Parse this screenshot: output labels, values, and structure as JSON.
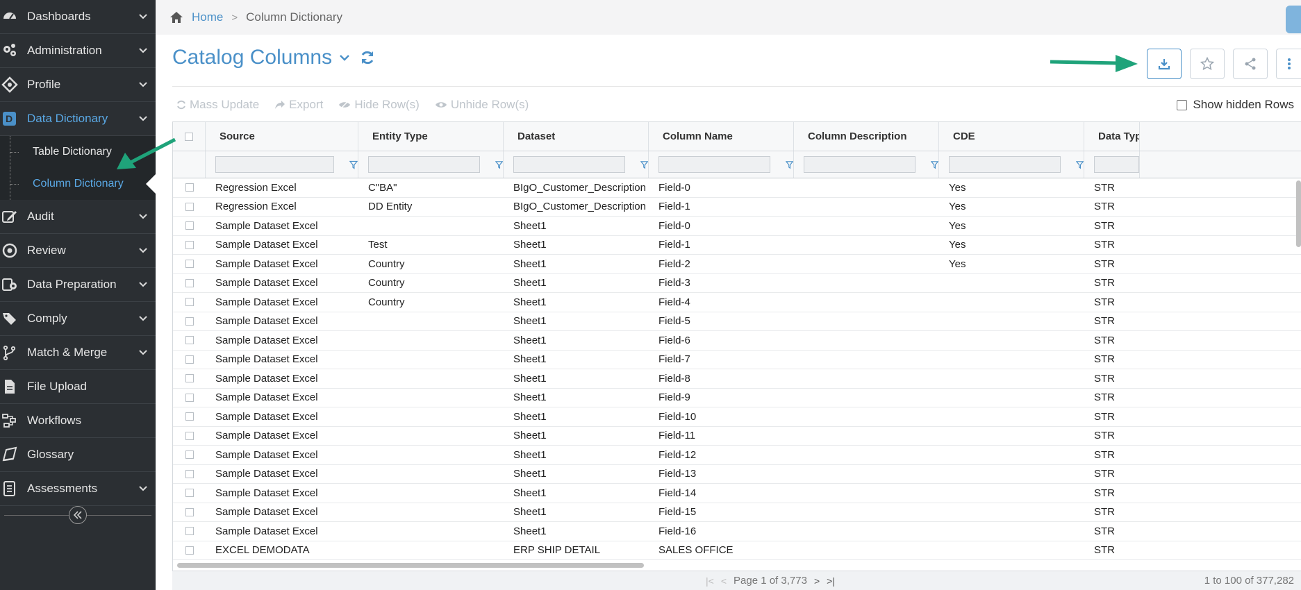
{
  "sidebar": {
    "items": [
      {
        "label": "Dashboards",
        "icon": "dashboard-icon",
        "expandable": true
      },
      {
        "label": "Administration",
        "icon": "gears-icon",
        "expandable": true
      },
      {
        "label": "Profile",
        "icon": "profile-icon",
        "expandable": true
      },
      {
        "label": "Data Dictionary",
        "icon": "data-dictionary-icon",
        "expandable": true,
        "active": true
      },
      {
        "label": "Audit",
        "icon": "audit-edit-icon",
        "expandable": true
      },
      {
        "label": "Review",
        "icon": "review-icon",
        "expandable": true
      },
      {
        "label": "Data Preparation",
        "icon": "data-preparation-icon",
        "expandable": true
      },
      {
        "label": "Comply",
        "icon": "tags-icon",
        "expandable": true
      },
      {
        "label": "Match & Merge",
        "icon": "branch-icon",
        "expandable": true
      },
      {
        "label": "File Upload",
        "icon": "file-icon",
        "expandable": false
      },
      {
        "label": "Workflows",
        "icon": "workflow-icon",
        "expandable": false
      },
      {
        "label": "Glossary",
        "icon": "book-icon",
        "expandable": false
      },
      {
        "label": "Assessments",
        "icon": "assessment-icon",
        "expandable": true
      }
    ],
    "sub_items": [
      {
        "label": "Table Dictionary"
      },
      {
        "label": "Column Dictionary",
        "current": true
      }
    ],
    "collapse_icon": "double-chevron-left-icon"
  },
  "breadcrumb": {
    "home": "Home",
    "current": "Column Dictionary"
  },
  "title": "Catalog Columns",
  "toolbar": {
    "mass_update": "Mass Update",
    "export": "Export",
    "hide_rows": "Hide Row(s)",
    "unhide_rows": "Unhide Row(s)",
    "show_hidden": "Show hidden Rows"
  },
  "colors": {
    "accent": "#4a90c8",
    "sidebar": "#2b2f33",
    "annotation_arrow": "#1fa37a"
  },
  "grid": {
    "columns": [
      "Source",
      "Entity Type",
      "Dataset",
      "Column Name",
      "Column Description",
      "CDE",
      "Data Typ"
    ],
    "rows": [
      [
        "Regression Excel",
        "C\"BA\"",
        "BIgO_Customer_Description",
        "Field-0",
        "",
        "Yes",
        "STR"
      ],
      [
        "Regression Excel",
        "DD Entity",
        "BIgO_Customer_Description",
        "Field-1",
        "",
        "Yes",
        "STR"
      ],
      [
        "Sample Dataset Excel",
        "",
        "Sheet1",
        "Field-0",
        "",
        "Yes",
        "STR"
      ],
      [
        "Sample Dataset Excel",
        "Test",
        "Sheet1",
        "Field-1",
        "",
        "Yes",
        "STR"
      ],
      [
        "Sample Dataset Excel",
        "Country",
        "Sheet1",
        "Field-2",
        "",
        "Yes",
        "STR"
      ],
      [
        "Sample Dataset Excel",
        "Country",
        "Sheet1",
        "Field-3",
        "",
        "",
        "STR"
      ],
      [
        "Sample Dataset Excel",
        "Country",
        "Sheet1",
        "Field-4",
        "",
        "",
        "STR"
      ],
      [
        "Sample Dataset Excel",
        "",
        "Sheet1",
        "Field-5",
        "",
        "",
        "STR"
      ],
      [
        "Sample Dataset Excel",
        "",
        "Sheet1",
        "Field-6",
        "",
        "",
        "STR"
      ],
      [
        "Sample Dataset Excel",
        "",
        "Sheet1",
        "Field-7",
        "",
        "",
        "STR"
      ],
      [
        "Sample Dataset Excel",
        "",
        "Sheet1",
        "Field-8",
        "",
        "",
        "STR"
      ],
      [
        "Sample Dataset Excel",
        "",
        "Sheet1",
        "Field-9",
        "",
        "",
        "STR"
      ],
      [
        "Sample Dataset Excel",
        "",
        "Sheet1",
        "Field-10",
        "",
        "",
        "STR"
      ],
      [
        "Sample Dataset Excel",
        "",
        "Sheet1",
        "Field-11",
        "",
        "",
        "STR"
      ],
      [
        "Sample Dataset Excel",
        "",
        "Sheet1",
        "Field-12",
        "",
        "",
        "STR"
      ],
      [
        "Sample Dataset Excel",
        "",
        "Sheet1",
        "Field-13",
        "",
        "",
        "STR"
      ],
      [
        "Sample Dataset Excel",
        "",
        "Sheet1",
        "Field-14",
        "",
        "",
        "STR"
      ],
      [
        "Sample Dataset Excel",
        "",
        "Sheet1",
        "Field-15",
        "",
        "",
        "STR"
      ],
      [
        "Sample Dataset Excel",
        "",
        "Sheet1",
        "Field-16",
        "",
        "",
        "STR"
      ],
      [
        "EXCEL DEMODATA",
        "",
        "ERP SHIP DETAIL",
        "SALES OFFICE",
        "",
        "",
        "STR"
      ]
    ]
  },
  "pager": {
    "page_text": "Page 1 of 3,773",
    "count_text": "1 to 100 of 377,282"
  }
}
